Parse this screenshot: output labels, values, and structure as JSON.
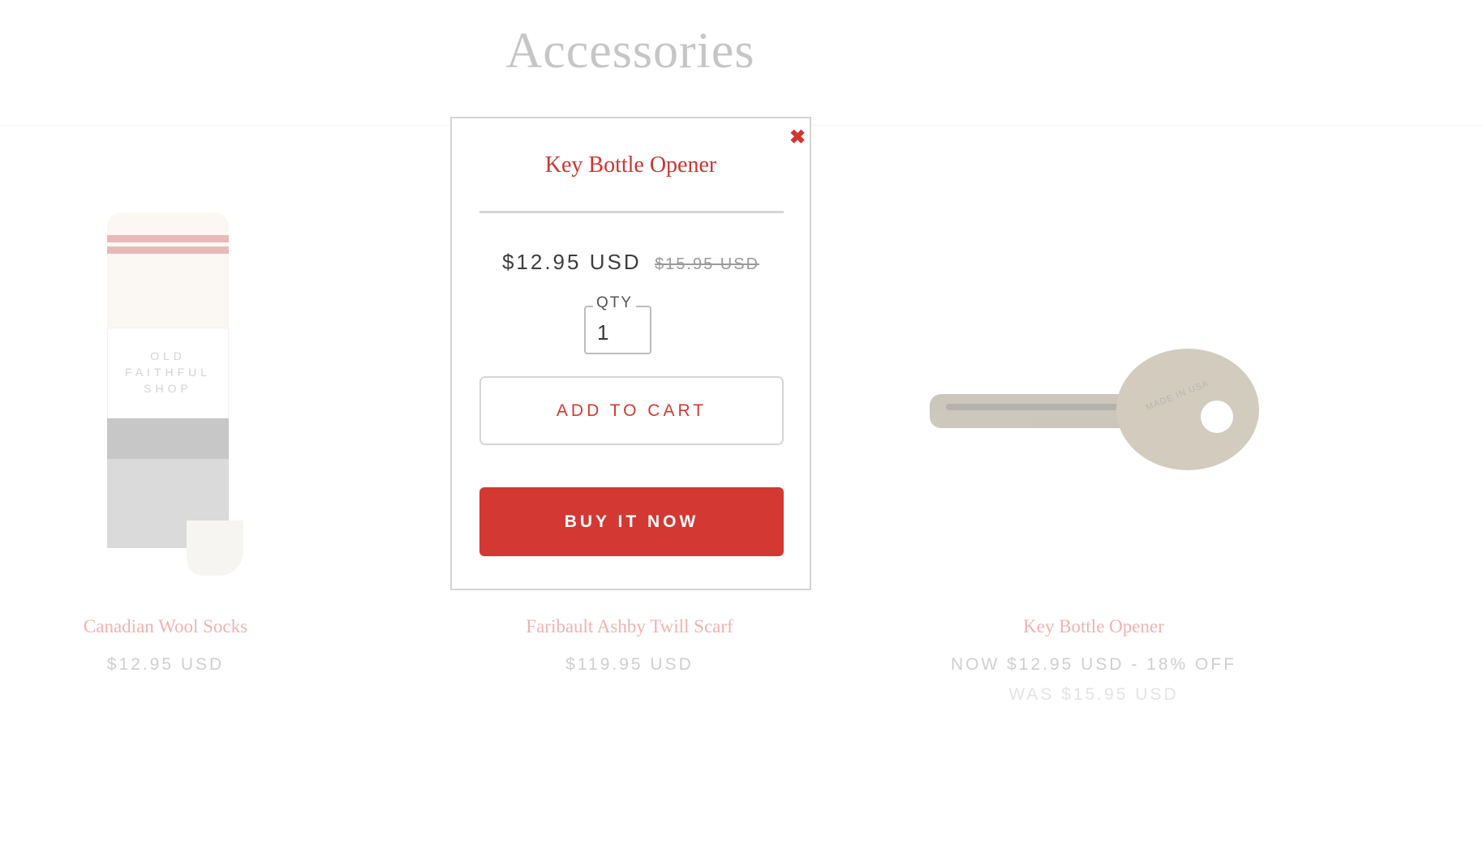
{
  "page": {
    "title": "Accessories"
  },
  "products": [
    {
      "name": "Canadian Wool Socks",
      "price": "$12.95 USD",
      "was": ""
    },
    {
      "name": "Faribault Ashby Twill Scarf",
      "price": "$119.95 USD",
      "was": ""
    },
    {
      "name": "Key Bottle Opener",
      "price": "NOW $12.95 USD - 18% OFF",
      "was": "WAS $15.95 USD"
    }
  ],
  "socks_image": {
    "label_lines": [
      "OLD",
      "FAITHFUL",
      "SHOP"
    ]
  },
  "key_image": {
    "engraving": "MADE IN USA"
  },
  "modal": {
    "title": "Key Bottle Opener",
    "price_now": "$12.95 USD",
    "price_was": "$15.95 USD",
    "qty_label": "QTY",
    "qty_value": "1",
    "add_to_cart_label": "ADD TO CART",
    "buy_now_label": "BUY IT NOW",
    "close_icon": "close-icon"
  },
  "colors": {
    "accent": "#d33832",
    "muted_title": "#c6c6c6",
    "faded_name": "#f0b3b0"
  }
}
